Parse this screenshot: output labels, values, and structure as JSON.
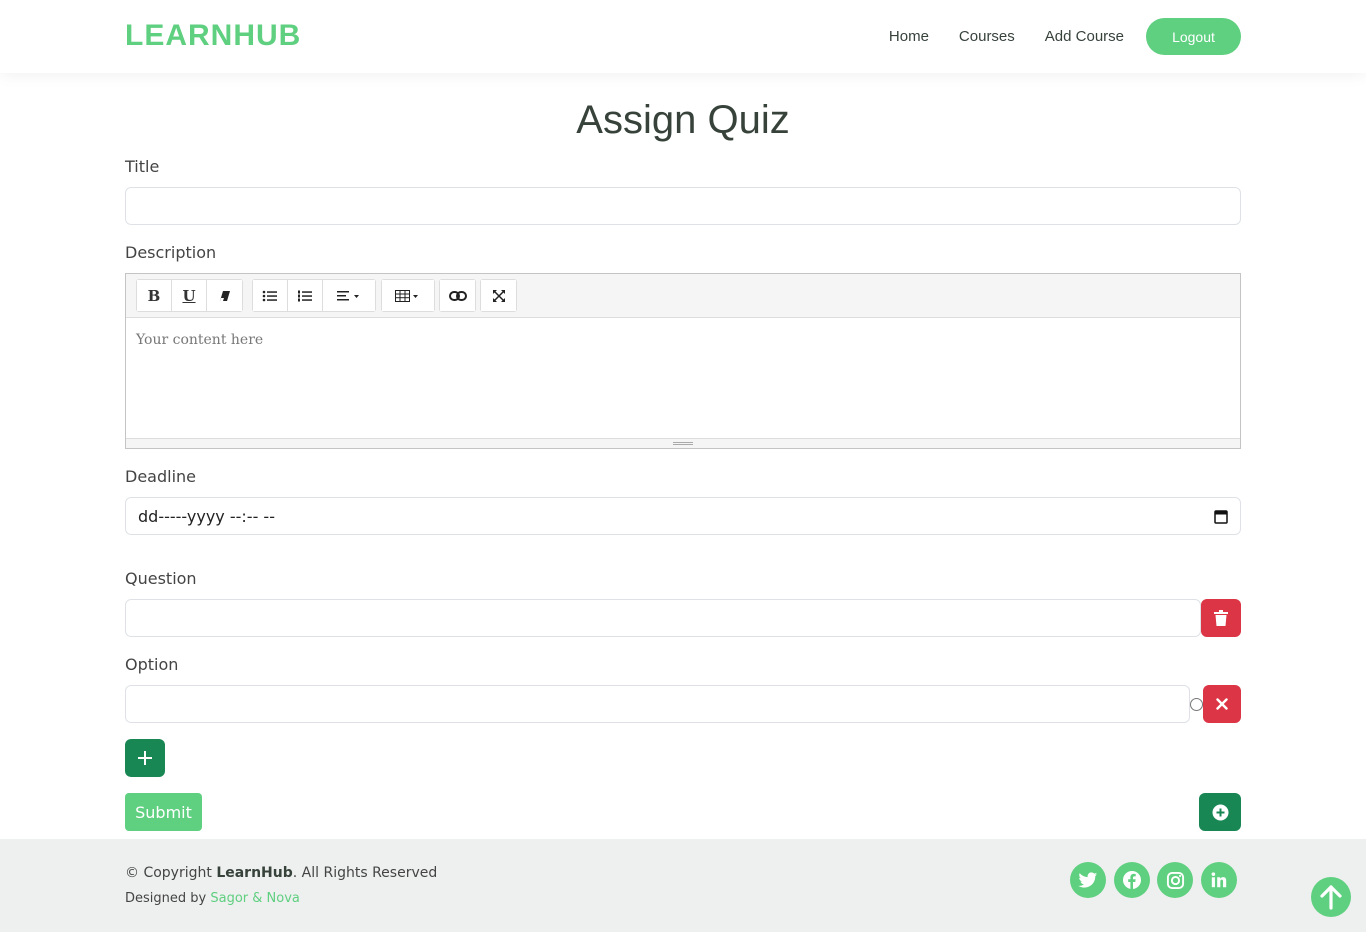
{
  "header": {
    "logo": "LEARNHUB",
    "nav": [
      "Home",
      "Courses",
      "Add Course"
    ],
    "logout_label": "Logout"
  },
  "page_title": "Assign Quiz",
  "form": {
    "title_label": "Title",
    "title_value": "",
    "description_label": "Description",
    "editor_placeholder": "Your content here",
    "deadline_label": "Deadline",
    "deadline_placeholder": "dd-----yyyy --:-- --",
    "question_label": "Question",
    "question_value": "",
    "option_label": "Option",
    "option_value": "",
    "submit_label": "Submit"
  },
  "toolbar": {
    "bold": "B",
    "underline": "U"
  },
  "footer": {
    "copyright_prefix": "© Copyright ",
    "brand": "LearnHub",
    "copyright_suffix": ". All Rights Reserved",
    "designed_by": "Designed by ",
    "designers": "Sagor & Nova"
  },
  "colors": {
    "brand": "#5fcf80",
    "danger": "#dc3545",
    "success": "#198754",
    "footer_bg": "#eef0ef"
  },
  "icons": [
    "trash-icon",
    "close-icon",
    "plus-icon",
    "plus-circle-icon",
    "twitter-icon",
    "facebook-icon",
    "instagram-icon",
    "linkedin-icon",
    "arrow-up-icon",
    "calendar-icon"
  ]
}
